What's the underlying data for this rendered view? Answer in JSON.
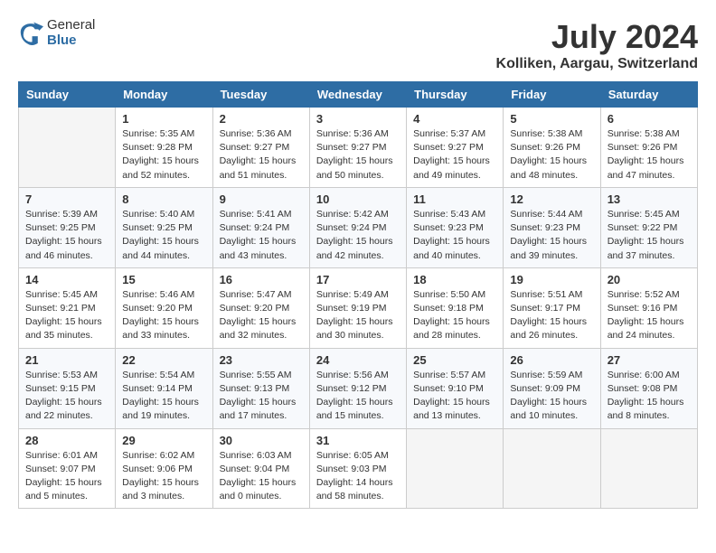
{
  "header": {
    "logo_general": "General",
    "logo_blue": "Blue",
    "month_title": "July 2024",
    "location": "Kolliken, Aargau, Switzerland"
  },
  "days_of_week": [
    "Sunday",
    "Monday",
    "Tuesday",
    "Wednesday",
    "Thursday",
    "Friday",
    "Saturday"
  ],
  "weeks": [
    [
      {
        "day": "",
        "info": ""
      },
      {
        "day": "1",
        "info": "Sunrise: 5:35 AM\nSunset: 9:28 PM\nDaylight: 15 hours\nand 52 minutes."
      },
      {
        "day": "2",
        "info": "Sunrise: 5:36 AM\nSunset: 9:27 PM\nDaylight: 15 hours\nand 51 minutes."
      },
      {
        "day": "3",
        "info": "Sunrise: 5:36 AM\nSunset: 9:27 PM\nDaylight: 15 hours\nand 50 minutes."
      },
      {
        "day": "4",
        "info": "Sunrise: 5:37 AM\nSunset: 9:27 PM\nDaylight: 15 hours\nand 49 minutes."
      },
      {
        "day": "5",
        "info": "Sunrise: 5:38 AM\nSunset: 9:26 PM\nDaylight: 15 hours\nand 48 minutes."
      },
      {
        "day": "6",
        "info": "Sunrise: 5:38 AM\nSunset: 9:26 PM\nDaylight: 15 hours\nand 47 minutes."
      }
    ],
    [
      {
        "day": "7",
        "info": "Sunrise: 5:39 AM\nSunset: 9:25 PM\nDaylight: 15 hours\nand 46 minutes."
      },
      {
        "day": "8",
        "info": "Sunrise: 5:40 AM\nSunset: 9:25 PM\nDaylight: 15 hours\nand 44 minutes."
      },
      {
        "day": "9",
        "info": "Sunrise: 5:41 AM\nSunset: 9:24 PM\nDaylight: 15 hours\nand 43 minutes."
      },
      {
        "day": "10",
        "info": "Sunrise: 5:42 AM\nSunset: 9:24 PM\nDaylight: 15 hours\nand 42 minutes."
      },
      {
        "day": "11",
        "info": "Sunrise: 5:43 AM\nSunset: 9:23 PM\nDaylight: 15 hours\nand 40 minutes."
      },
      {
        "day": "12",
        "info": "Sunrise: 5:44 AM\nSunset: 9:23 PM\nDaylight: 15 hours\nand 39 minutes."
      },
      {
        "day": "13",
        "info": "Sunrise: 5:45 AM\nSunset: 9:22 PM\nDaylight: 15 hours\nand 37 minutes."
      }
    ],
    [
      {
        "day": "14",
        "info": "Sunrise: 5:45 AM\nSunset: 9:21 PM\nDaylight: 15 hours\nand 35 minutes."
      },
      {
        "day": "15",
        "info": "Sunrise: 5:46 AM\nSunset: 9:20 PM\nDaylight: 15 hours\nand 33 minutes."
      },
      {
        "day": "16",
        "info": "Sunrise: 5:47 AM\nSunset: 9:20 PM\nDaylight: 15 hours\nand 32 minutes."
      },
      {
        "day": "17",
        "info": "Sunrise: 5:49 AM\nSunset: 9:19 PM\nDaylight: 15 hours\nand 30 minutes."
      },
      {
        "day": "18",
        "info": "Sunrise: 5:50 AM\nSunset: 9:18 PM\nDaylight: 15 hours\nand 28 minutes."
      },
      {
        "day": "19",
        "info": "Sunrise: 5:51 AM\nSunset: 9:17 PM\nDaylight: 15 hours\nand 26 minutes."
      },
      {
        "day": "20",
        "info": "Sunrise: 5:52 AM\nSunset: 9:16 PM\nDaylight: 15 hours\nand 24 minutes."
      }
    ],
    [
      {
        "day": "21",
        "info": "Sunrise: 5:53 AM\nSunset: 9:15 PM\nDaylight: 15 hours\nand 22 minutes."
      },
      {
        "day": "22",
        "info": "Sunrise: 5:54 AM\nSunset: 9:14 PM\nDaylight: 15 hours\nand 19 minutes."
      },
      {
        "day": "23",
        "info": "Sunrise: 5:55 AM\nSunset: 9:13 PM\nDaylight: 15 hours\nand 17 minutes."
      },
      {
        "day": "24",
        "info": "Sunrise: 5:56 AM\nSunset: 9:12 PM\nDaylight: 15 hours\nand 15 minutes."
      },
      {
        "day": "25",
        "info": "Sunrise: 5:57 AM\nSunset: 9:10 PM\nDaylight: 15 hours\nand 13 minutes."
      },
      {
        "day": "26",
        "info": "Sunrise: 5:59 AM\nSunset: 9:09 PM\nDaylight: 15 hours\nand 10 minutes."
      },
      {
        "day": "27",
        "info": "Sunrise: 6:00 AM\nSunset: 9:08 PM\nDaylight: 15 hours\nand 8 minutes."
      }
    ],
    [
      {
        "day": "28",
        "info": "Sunrise: 6:01 AM\nSunset: 9:07 PM\nDaylight: 15 hours\nand 5 minutes."
      },
      {
        "day": "29",
        "info": "Sunrise: 6:02 AM\nSunset: 9:06 PM\nDaylight: 15 hours\nand 3 minutes."
      },
      {
        "day": "30",
        "info": "Sunrise: 6:03 AM\nSunset: 9:04 PM\nDaylight: 15 hours\nand 0 minutes."
      },
      {
        "day": "31",
        "info": "Sunrise: 6:05 AM\nSunset: 9:03 PM\nDaylight: 14 hours\nand 58 minutes."
      },
      {
        "day": "",
        "info": ""
      },
      {
        "day": "",
        "info": ""
      },
      {
        "day": "",
        "info": ""
      }
    ]
  ]
}
